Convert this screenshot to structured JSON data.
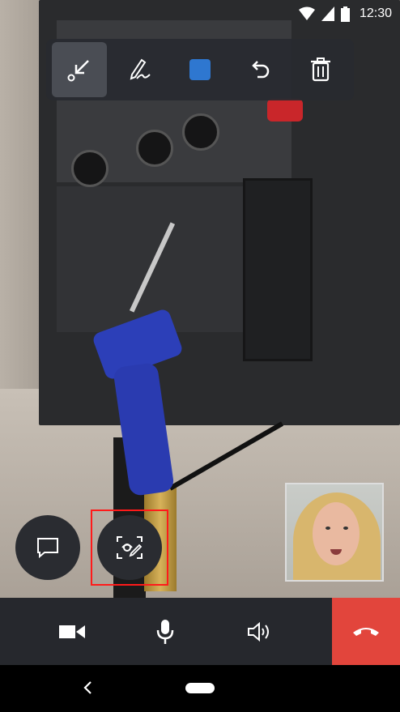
{
  "status": {
    "time": "12:30"
  },
  "toolbar": {
    "tools": [
      {
        "name": "collapse",
        "icon": "collapse-arrow-icon",
        "active": true
      },
      {
        "name": "pen",
        "icon": "pen-icon"
      },
      {
        "name": "color",
        "icon": "color-swatch",
        "color": "#2e77d0"
      },
      {
        "name": "undo",
        "icon": "undo-icon"
      },
      {
        "name": "delete",
        "icon": "trash-icon"
      }
    ]
  },
  "actions": {
    "chat_icon": "chat-bubble-icon",
    "annotate_icon": "annotate-snapshot-icon"
  },
  "callbar": {
    "video_icon": "video-camera-icon",
    "mic_icon": "microphone-icon",
    "speaker_icon": "speaker-icon",
    "end_icon": "end-call-icon",
    "end_color": "#e2453c"
  },
  "nav": {
    "back_icon": "back-chevron-icon",
    "home_icon": "home-pill-icon"
  }
}
